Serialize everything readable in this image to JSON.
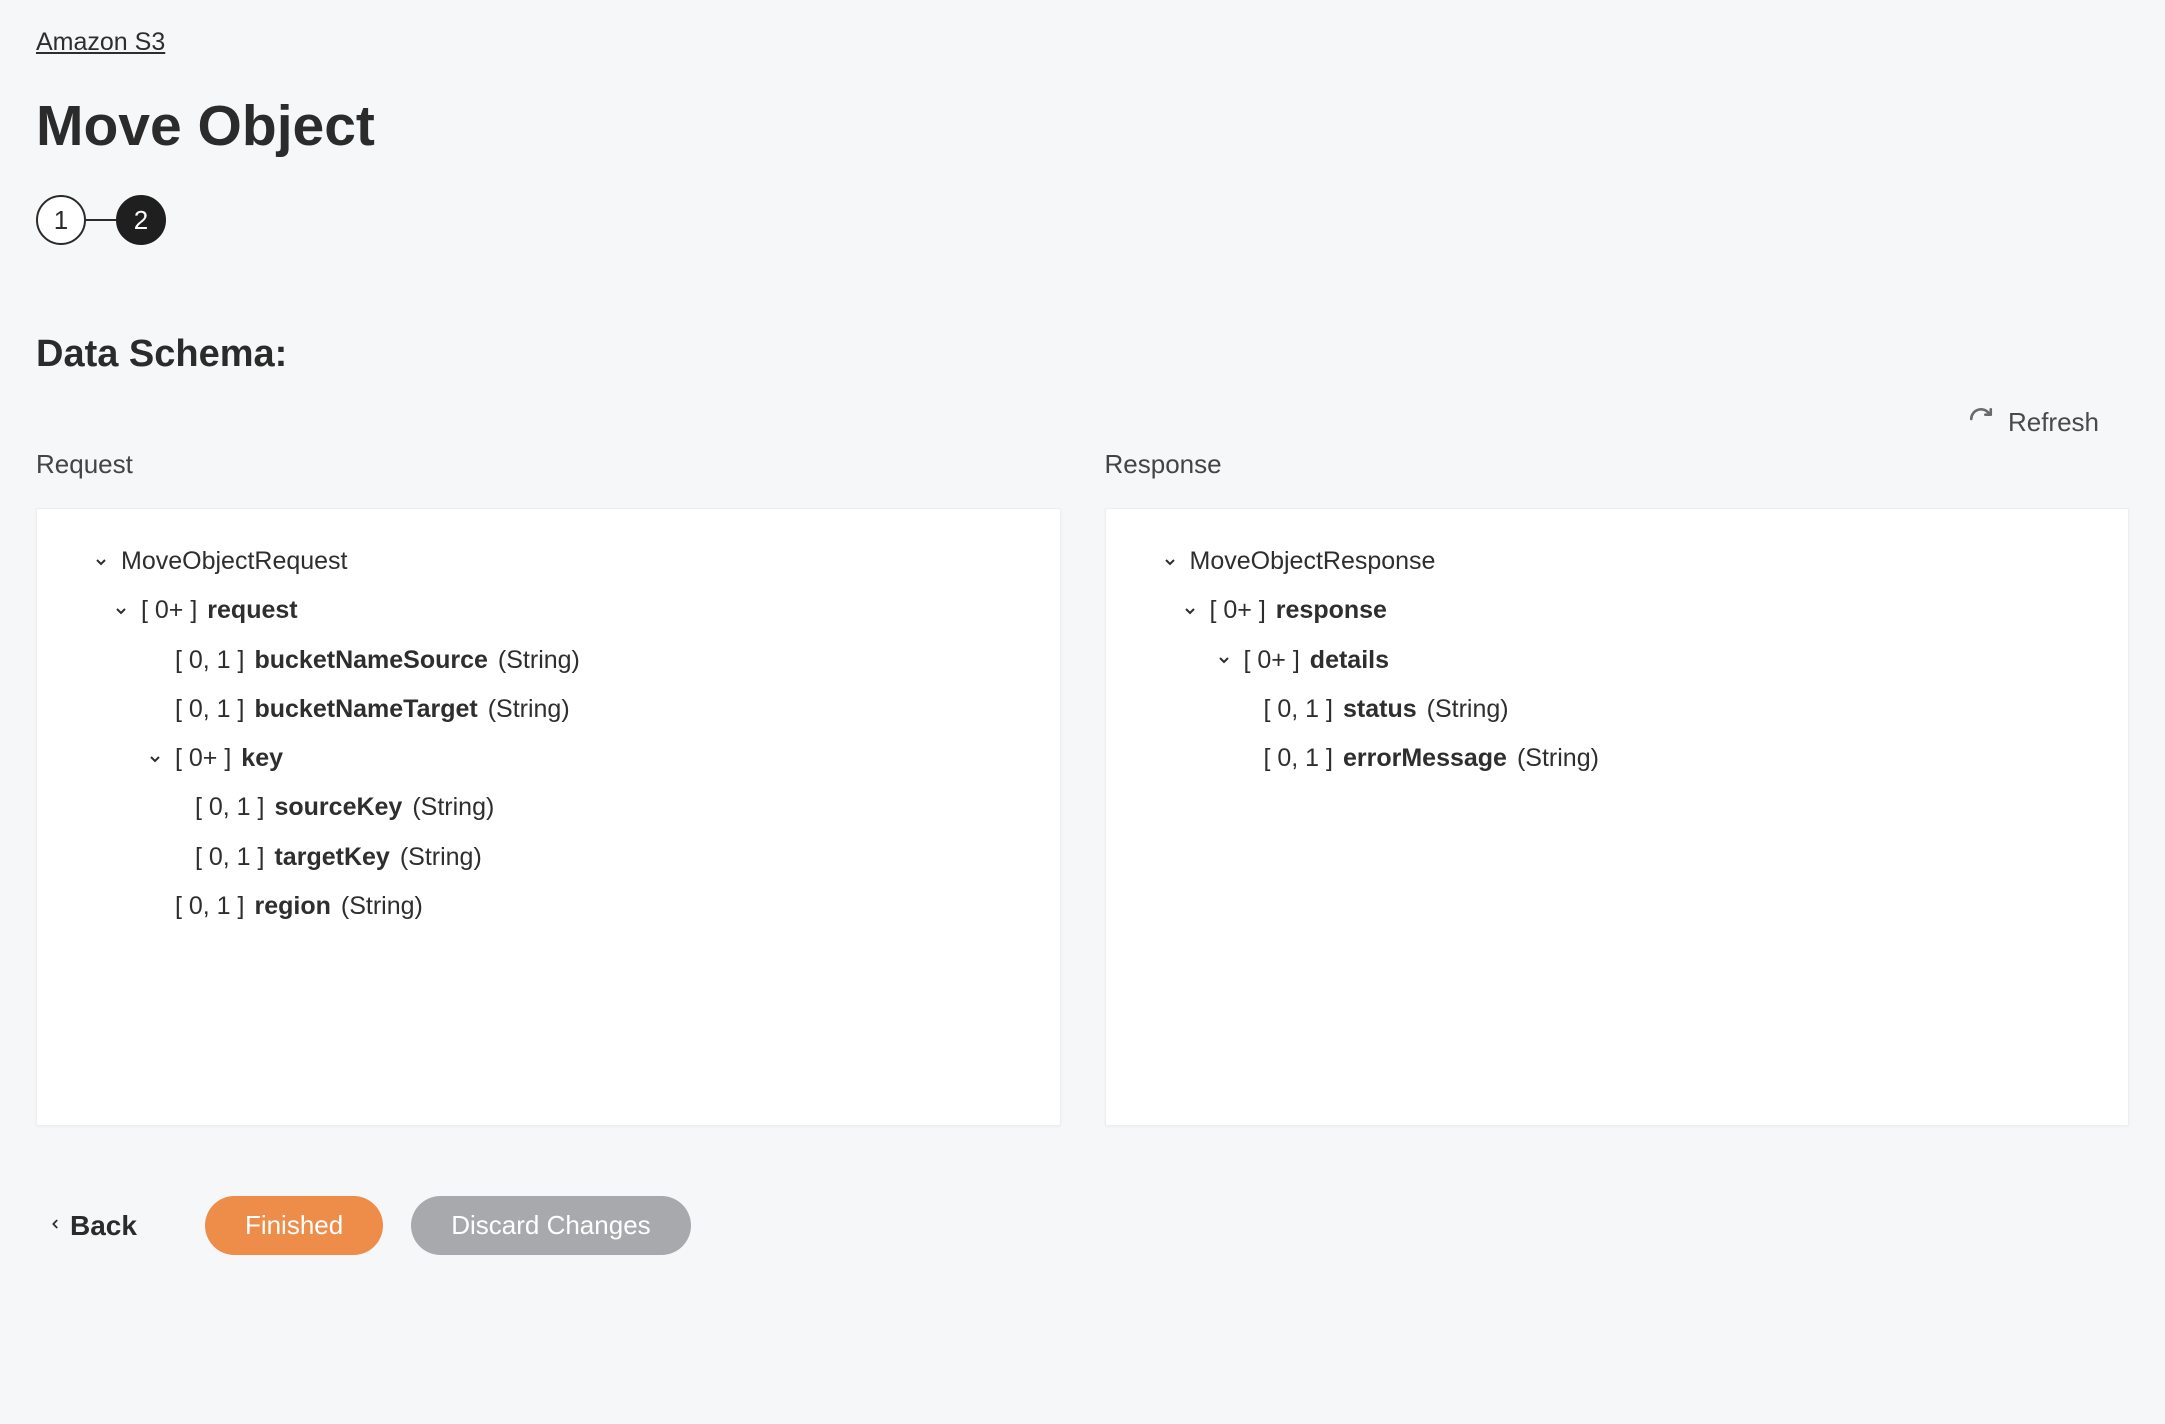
{
  "breadcrumb": "Amazon S3",
  "pageTitle": "Move Object",
  "stepper": {
    "step1": "1",
    "step2": "2"
  },
  "sectionHeading": "Data Schema:",
  "refreshLabel": "Refresh",
  "columns": {
    "request": {
      "title": "Request",
      "root": "MoveObjectRequest",
      "items": {
        "request": {
          "card": "[ 0+ ]",
          "name": "request"
        },
        "bucketNameSource": {
          "card": "[ 0, 1 ]",
          "name": "bucketNameSource",
          "type": "(String)"
        },
        "bucketNameTarget": {
          "card": "[ 0, 1 ]",
          "name": "bucketNameTarget",
          "type": "(String)"
        },
        "key": {
          "card": "[ 0+ ]",
          "name": "key"
        },
        "sourceKey": {
          "card": "[ 0, 1 ]",
          "name": "sourceKey",
          "type": "(String)"
        },
        "targetKey": {
          "card": "[ 0, 1 ]",
          "name": "targetKey",
          "type": "(String)"
        },
        "region": {
          "card": "[ 0, 1 ]",
          "name": "region",
          "type": "(String)"
        }
      }
    },
    "response": {
      "title": "Response",
      "root": "MoveObjectResponse",
      "items": {
        "response": {
          "card": "[ 0+ ]",
          "name": "response"
        },
        "details": {
          "card": "[ 0+ ]",
          "name": "details"
        },
        "status": {
          "card": "[ 0, 1 ]",
          "name": "status",
          "type": "(String)"
        },
        "errorMessage": {
          "card": "[ 0, 1 ]",
          "name": "errorMessage",
          "type": "(String)"
        }
      }
    }
  },
  "footer": {
    "back": "Back",
    "finished": "Finished",
    "discard": "Discard Changes"
  }
}
